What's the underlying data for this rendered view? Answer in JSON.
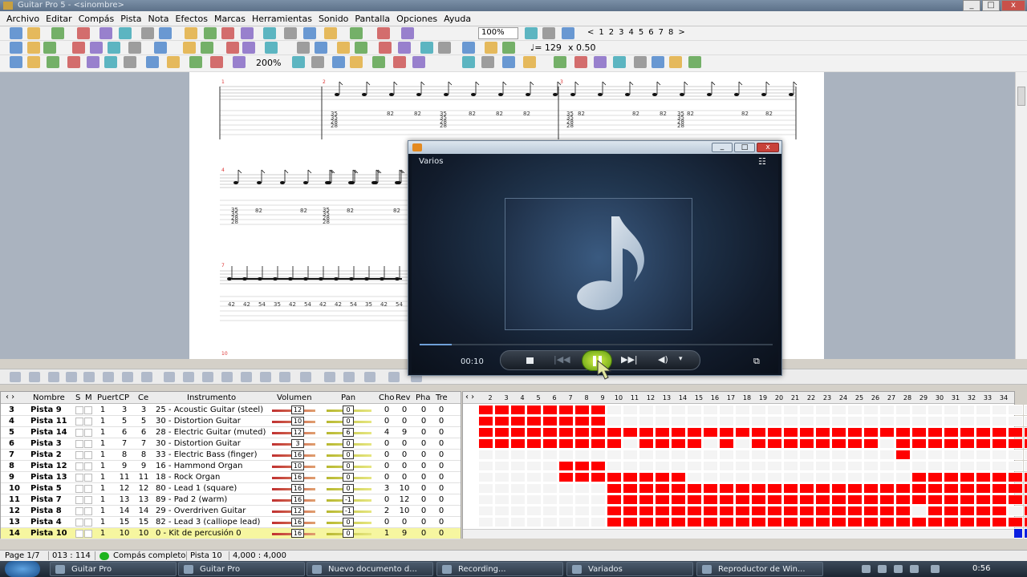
{
  "window": {
    "title": "Guitar Pro 5 - <sinombre>"
  },
  "menu": [
    "Archivo",
    "Editar",
    "Compás",
    "Pista",
    "Nota",
    "Efectos",
    "Marcas",
    "Herramientas",
    "Sonido",
    "Pantalla",
    "Opciones",
    "Ayuda"
  ],
  "toolbar1": {
    "zoom": "100%",
    "pages": [
      "<",
      "1",
      "2",
      "3",
      "4",
      "5",
      "6",
      "7",
      "8",
      ">"
    ]
  },
  "toolbar2": {
    "tempo": "♩= 129",
    "speed": "x 0.50"
  },
  "toolbar3": {
    "zoom2": "200%"
  },
  "score": {
    "measure_numbers": [
      "1",
      "2",
      "3",
      "4",
      "7",
      "10"
    ],
    "tab_row1": "35 35 28 28",
    "tab_82": "82",
    "tab_row3": [
      "42",
      "42",
      "54",
      "35",
      "42",
      "54",
      "42",
      "42",
      "54",
      "35",
      "42",
      "54"
    ]
  },
  "wmp": {
    "now_playing": "Varios",
    "time": "00:10",
    "progress": 0.09
  },
  "tracks": {
    "headers": [
      "Nombre",
      "S",
      "M",
      "Puert",
      "CP",
      "Ce",
      "Instrumento",
      "Volumen",
      "Pan",
      "Cho",
      "Rev",
      "Pha",
      "Tre"
    ],
    "rows": [
      {
        "n": "3",
        "name": "Pista 9",
        "p": "1",
        "cp": "3",
        "ce": "3",
        "inst": "25 - Acoustic Guitar (steel)",
        "vol": "12",
        "pan": "0",
        "cho": "0",
        "rev": "0",
        "pha": "0",
        "tre": "0"
      },
      {
        "n": "4",
        "name": "Pista 11",
        "p": "1",
        "cp": "5",
        "ce": "5",
        "inst": "30 - Distortion Guitar",
        "vol": "10",
        "pan": "0",
        "cho": "0",
        "rev": "0",
        "pha": "0",
        "tre": "0"
      },
      {
        "n": "5",
        "name": "Pista 14",
        "p": "1",
        "cp": "6",
        "ce": "6",
        "inst": "28 - Electric Guitar (muted)",
        "vol": "12",
        "pan": "6",
        "cho": "4",
        "rev": "9",
        "pha": "0",
        "tre": "0"
      },
      {
        "n": "6",
        "name": "Pista 3",
        "p": "1",
        "cp": "7",
        "ce": "7",
        "inst": "30 - Distortion Guitar",
        "vol": "3",
        "pan": "0",
        "cho": "0",
        "rev": "0",
        "pha": "0",
        "tre": "0"
      },
      {
        "n": "7",
        "name": "Pista 2",
        "p": "1",
        "cp": "8",
        "ce": "8",
        "inst": "33 - Electric Bass (finger)",
        "vol": "16",
        "pan": "0",
        "cho": "0",
        "rev": "0",
        "pha": "0",
        "tre": "0"
      },
      {
        "n": "8",
        "name": "Pista 12",
        "p": "1",
        "cp": "9",
        "ce": "9",
        "inst": "16 - Hammond Organ",
        "vol": "10",
        "pan": "0",
        "cho": "0",
        "rev": "0",
        "pha": "0",
        "tre": "0"
      },
      {
        "n": "9",
        "name": "Pista 13",
        "p": "1",
        "cp": "11",
        "ce": "11",
        "inst": "18 - Rock Organ",
        "vol": "16",
        "pan": "0",
        "cho": "0",
        "rev": "0",
        "pha": "0",
        "tre": "0"
      },
      {
        "n": "10",
        "name": "Pista 5",
        "p": "1",
        "cp": "12",
        "ce": "12",
        "inst": "80 - Lead 1 (square)",
        "vol": "16",
        "pan": "0",
        "cho": "3",
        "rev": "10",
        "pha": "0",
        "tre": "0"
      },
      {
        "n": "11",
        "name": "Pista 7",
        "p": "1",
        "cp": "13",
        "ce": "13",
        "inst": "89 - Pad 2 (warm)",
        "vol": "16",
        "pan": "-1",
        "cho": "0",
        "rev": "12",
        "pha": "0",
        "tre": "0"
      },
      {
        "n": "12",
        "name": "Pista 8",
        "p": "1",
        "cp": "14",
        "ce": "14",
        "inst": "29 - Overdriven Guitar",
        "vol": "12",
        "pan": "-1",
        "cho": "2",
        "rev": "10",
        "pha": "0",
        "tre": "0"
      },
      {
        "n": "13",
        "name": "Pista 4",
        "p": "1",
        "cp": "15",
        "ce": "15",
        "inst": "82 - Lead 3 (calliope lead)",
        "vol": "16",
        "pan": "0",
        "cho": "0",
        "rev": "0",
        "pha": "0",
        "tre": "0"
      },
      {
        "n": "14",
        "name": "Pista 10",
        "p": "1",
        "cp": "10",
        "ce": "10",
        "inst": "0 - Kit de percusión 0",
        "vol": "16",
        "pan": "0",
        "cho": "1",
        "rev": "9",
        "pha": "0",
        "tre": "0"
      }
    ]
  },
  "grid": {
    "columns": [
      "2",
      "3",
      "4",
      "5",
      "6",
      "7",
      "8",
      "9",
      "10",
      "11",
      "12",
      "13",
      "14",
      "15",
      "16",
      "17",
      "18",
      "19",
      "20",
      "21",
      "22",
      "23",
      "24",
      "25",
      "26",
      "27",
      "28",
      "29",
      "30",
      "31",
      "32",
      "33",
      "34"
    ],
    "rows": [
      "11111111000000000000000000000000000",
      "11111111000000000000000000000000000",
      "11111111111111111111111111111111111",
      "11111111101111010111111110111111111",
      "00000000000000000000000000100000000",
      "00000111000000000000000000000000000",
      "00000111111110000000000000011111111",
      "00000000111111111111111111111111111",
      "00000000111111111111111111111111111",
      "00000000111111111111111111101111101",
      "00000000111111111111111111111111111",
      "22222222222222222222222222222222222"
    ]
  },
  "status": {
    "page": "Page 1/7",
    "pos": "013 : 114",
    "ok": "Compás completo",
    "track": "Pista 10",
    "time": "4,000 : 4,000"
  },
  "taskbar": {
    "items": [
      "Guitar Pro",
      "Guitar Pro",
      "Nuevo documento d...",
      "Recording...",
      "Variados",
      "Reproductor de Win..."
    ],
    "clock": "0:56"
  }
}
